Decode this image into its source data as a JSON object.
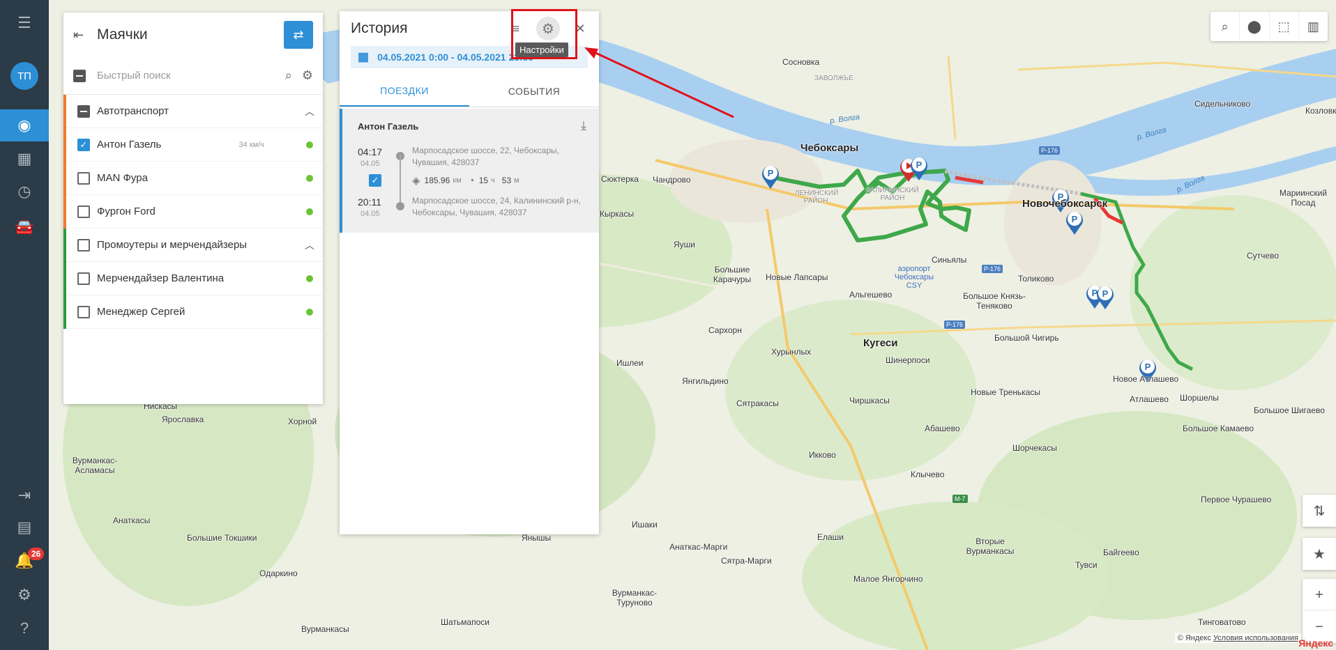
{
  "rail": {
    "avatar": "ТП",
    "badge": "26",
    "icons": [
      "collapse-icon",
      "globe-icon",
      "chart-icon",
      "clock-icon",
      "car-icon",
      "logout-icon",
      "chat-icon",
      "bell-icon",
      "gear-icon",
      "help-icon"
    ]
  },
  "beacons": {
    "title": "Маячки",
    "search_placeholder": "Быстрый поиск",
    "groups": [
      {
        "name": "Автотранспорт",
        "color": "#f07b2d",
        "items": [
          {
            "name": "Антон Газель",
            "speed": "34 км/ч",
            "checked": true
          },
          {
            "name": "MAN Фура",
            "speed": "",
            "checked": false
          },
          {
            "name": "Фургон Ford",
            "speed": "",
            "checked": false
          }
        ]
      },
      {
        "name": "Промоутеры и мерчендайзеры",
        "color": "#2e9a3c",
        "items": [
          {
            "name": "Мерчендайзер Валентина",
            "speed": "",
            "checked": false
          },
          {
            "name": "Менеджер Сергей",
            "speed": "",
            "checked": false
          }
        ]
      }
    ]
  },
  "history": {
    "title": "История",
    "date_range": "04.05.2021 0:00 - 04.05.2021 23:59",
    "tabs": [
      "ПОЕЗДКИ",
      "СОБЫТИЯ"
    ],
    "tooltip": "Настройки",
    "trip": {
      "who": "Антон Газель",
      "start_time": "04:17",
      "start_date": "04.05",
      "start_address": "Марпосадское шоссе, 22, Чебоксары, Чувашия, 428037",
      "end_time": "20:11",
      "end_date": "04.05",
      "end_address": "Марпосадское шоссе, 24, Калининский р-н, Чебоксары, Чувашия, 428037",
      "distance": "185.96",
      "distance_unit": "км",
      "duration_h": "15",
      "duration_h_unit": "ч",
      "duration_m": "53",
      "duration_m_unit": "м"
    }
  },
  "map": {
    "labels": {
      "cheboksary": "Чебоксары",
      "novocheboksarsk": "Новочебоксарск",
      "kugesi": "Кугеси",
      "sosnovka": "Сосновка",
      "zavolzhye": "ЗАВОЛЖЬЕ",
      "volga1": "р. Волга",
      "volga2": "р. Волга",
      "volga3": "р. Волга",
      "sidelnikovo": "Сидельниково",
      "kozlovka": "Козловк",
      "marinsky": "Мариинский Посад",
      "sutchevo": "Сутчево",
      "syuktera": "Сюктерка",
      "chandrovo": "Чандрово",
      "kyrkasy": "Кыркасы",
      "yaushi": "Яуши",
      "b_karachury": "Большие Карачуры",
      "n_lapsary": "Новые Лапсары",
      "algeshevo": "Альгешево",
      "sinyaly": "Синьялы",
      "airport": "аэропорт Чебоксары CSY",
      "tolikovo": "Толиково",
      "b_knyaz": "Большое Князь-Теняково",
      "sarhorn": "Сархорн",
      "hurynlyh": "Хурынлых",
      "b_chigir": "Большой Чигирь",
      "ishlei": "Ишлеи",
      "yangildino": "Янгильдино",
      "shinerposi": "Шинерпоси",
      "n_atlashevo": "Новое Атлашево",
      "atlashevo": "Атлашево",
      "shorshely": "Шоршелы",
      "syatrakasy": "Сятракасы",
      "chirshkasy": "Чиршкасы",
      "n_trenkasy": "Новые Тренькасы",
      "b_shigaevo": "Большое Шигаево",
      "niskasy": "Нискасы",
      "yaroslavka": "Ярославка",
      "khorny": "Хорной",
      "abashevo": "Абашево",
      "b_kamaevo": "Большое Камаево",
      "shorchekasy": "Шорчекасы",
      "ikkovo": "Икково",
      "klychevo": "Клычево",
      "vurmankas_aslamasy": "Вурманкас-Асламасы",
      "ankaskasy": "Анаткасы",
      "b_tokshiki": "Большие Токшики",
      "ishaki": "Ишаки",
      "yanshi": "Янышы",
      "ankaskas_margi": "Анаткас-Марги",
      "elashi": "Елаши",
      "syatra_margi": "Сятра-Марги",
      "v_vurmankasy": "Вторые Вурманкасы",
      "baygeevo": "Байгеево",
      "m_yangorchino": "Малое Янгорчино",
      "tuvsi": "Тувси",
      "pervoe_churashevo": "Первое Чурашево",
      "odarkino": "Одаркино",
      "vurmankas_turunovo": "Вурманкас-Туруново",
      "shatmaposi": "Шатьмапоси",
      "tingovatovo": "Тинговатово",
      "vurmankasy": "Вурманкасы",
      "lenin_district": "ЛЕНИНСКИЙ РАЙОН",
      "kalinin_district": "КАЛИНИНСКИЙ РАЙОН",
      "r176a": "Р-176",
      "r176b": "Р-176",
      "r176c": "Р-176",
      "m7": "М-7"
    },
    "copyright": "© Яндекс",
    "terms": "Условия использования",
    "logo": "Яндекс"
  },
  "colors": {
    "rail_bg": "#2b3b47",
    "accent": "#2d8fd5",
    "online": "#6ac435",
    "route": "#3ea84a",
    "highlight": "#e0121a"
  }
}
